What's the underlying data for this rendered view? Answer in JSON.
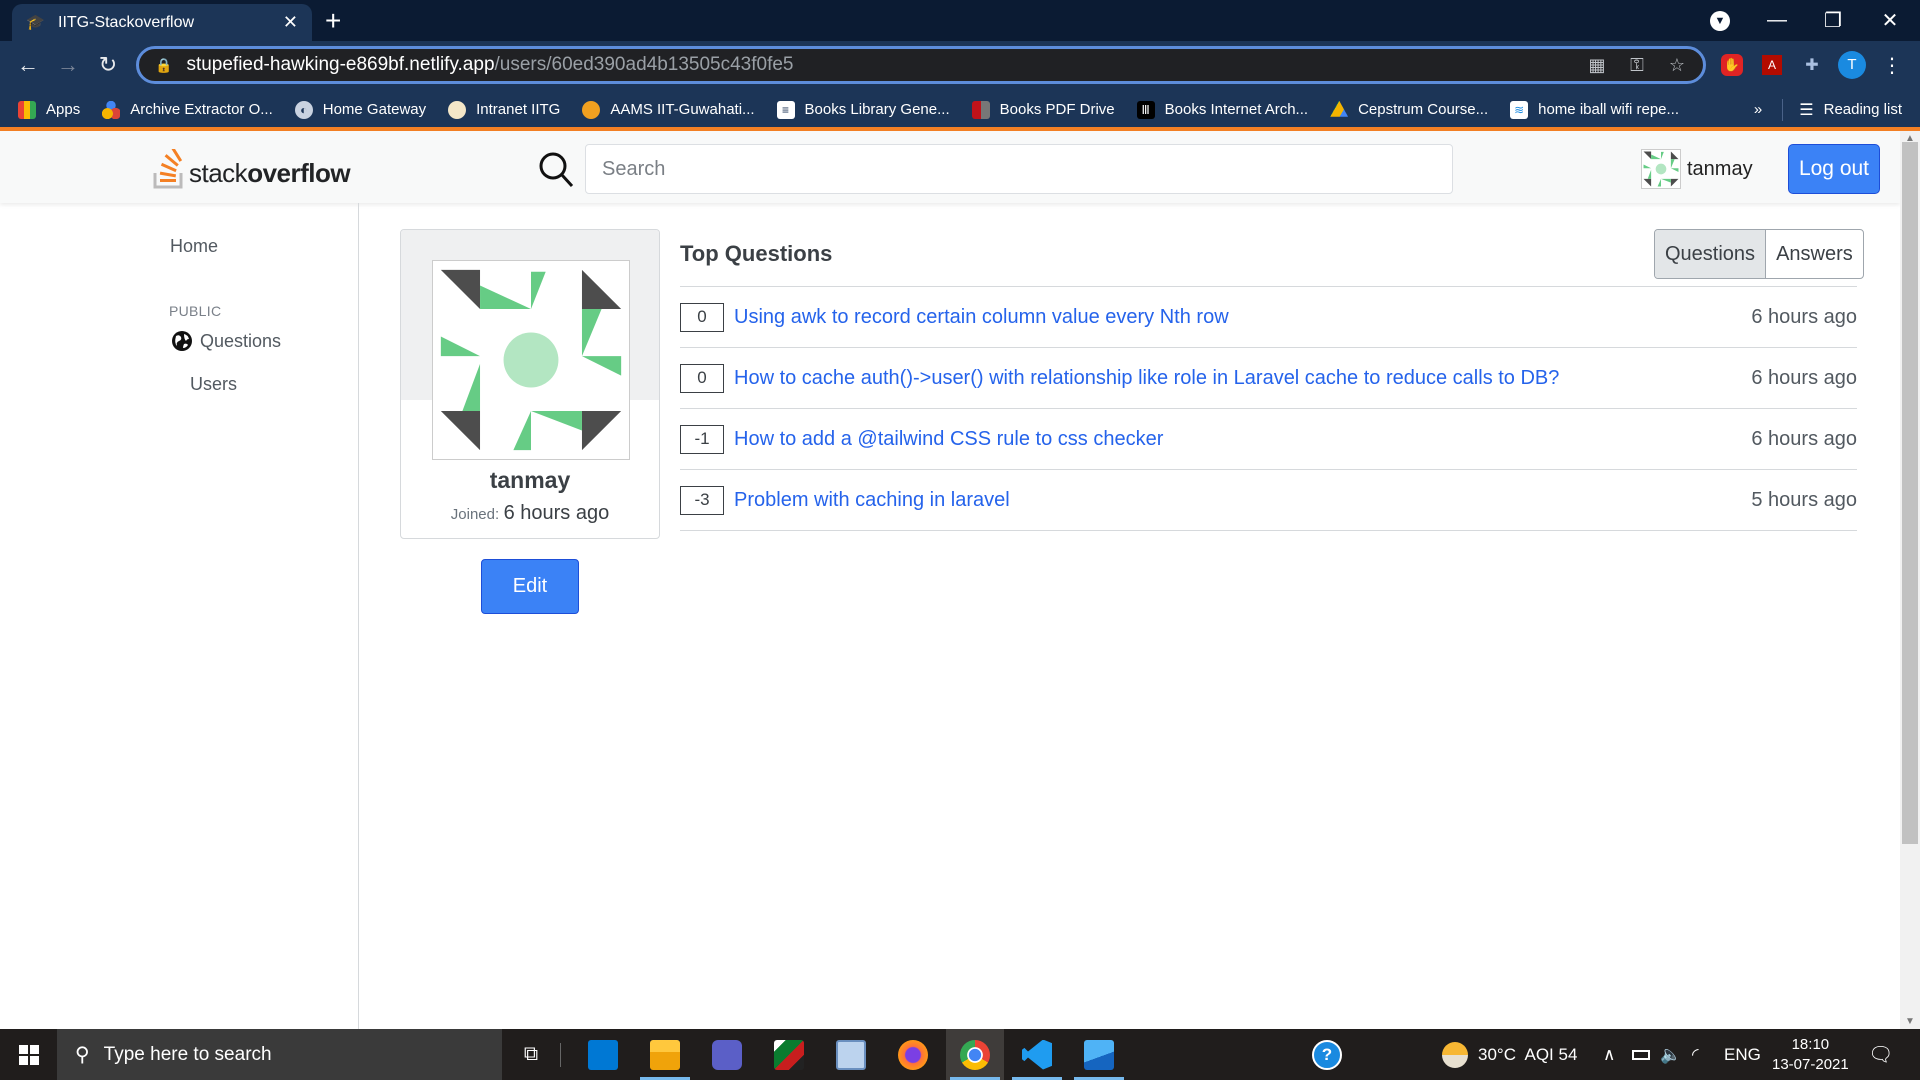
{
  "browser": {
    "tab_title": "IITG-Stackoverflow",
    "new_tab": "+",
    "tab_close": "✕",
    "url_host": "stupefied-hawking-e869bf.netlify.app",
    "url_path": "/users/60ed390ad4b13505c43f0fe5",
    "profile_initial": "T",
    "bookmarks": [
      {
        "label": "Apps",
        "icon": "apps-grid-icon"
      },
      {
        "label": "Archive Extractor O...",
        "icon": "archive-extractor-icon"
      },
      {
        "label": "Home Gateway",
        "icon": "globe-icon"
      },
      {
        "label": "Intranet IITG",
        "icon": "iitg-logo-icon"
      },
      {
        "label": "AAMS IIT-Guwahati...",
        "icon": "iitg-logo-icon"
      },
      {
        "label": "Books Library Gene...",
        "icon": "library-icon"
      },
      {
        "label": "Books PDF Drive",
        "icon": "pdf-drive-icon"
      },
      {
        "label": "Books Internet Arch...",
        "icon": "internet-archive-icon"
      },
      {
        "label": "Cepstrum Course...",
        "icon": "google-drive-icon"
      },
      {
        "label": "home iball wifi repe...",
        "icon": "wifi-icon"
      }
    ],
    "more_bookmarks": "»",
    "reading_list": "Reading list"
  },
  "header": {
    "logo_light": "stack",
    "logo_bold": "overflow",
    "search_placeholder": "Search",
    "username": "tanmay",
    "logout_label": "Log out"
  },
  "sidebar": {
    "home": "Home",
    "section": "PUBLIC",
    "questions": "Questions",
    "users": "Users"
  },
  "profile": {
    "name": "tanmay",
    "joined_label": "Joined:",
    "joined_value": "6 hours ago",
    "edit_label": "Edit"
  },
  "top_questions": {
    "title": "Top Questions",
    "toggle": [
      {
        "label": "Questions",
        "active": true
      },
      {
        "label": "Answers",
        "active": false
      }
    ],
    "items": [
      {
        "votes": "0",
        "title": "Using awk to record certain column value every Nth row",
        "time": "6 hours ago"
      },
      {
        "votes": "0",
        "title": "How to cache auth()->user() with relationship like role in Laravel cache to reduce calls to DB?",
        "time": "6 hours ago"
      },
      {
        "votes": "-1",
        "title": "How to add a @tailwind CSS rule to css checker",
        "time": "6 hours ago"
      },
      {
        "votes": "-3",
        "title": "Problem with caching in laravel",
        "time": "5 hours ago"
      }
    ]
  },
  "taskbar": {
    "search_placeholder": "Type here to search",
    "weather": "30°C  AQI 54",
    "language": "ENG",
    "time": "18:10",
    "date": "13-07-2021"
  },
  "colors": {
    "accent_blue": "#3b82f6",
    "link_blue": "#2563eb",
    "so_orange": "#f48024",
    "avatar_green": "#66cc85",
    "avatar_dark": "#4d4d4d"
  }
}
